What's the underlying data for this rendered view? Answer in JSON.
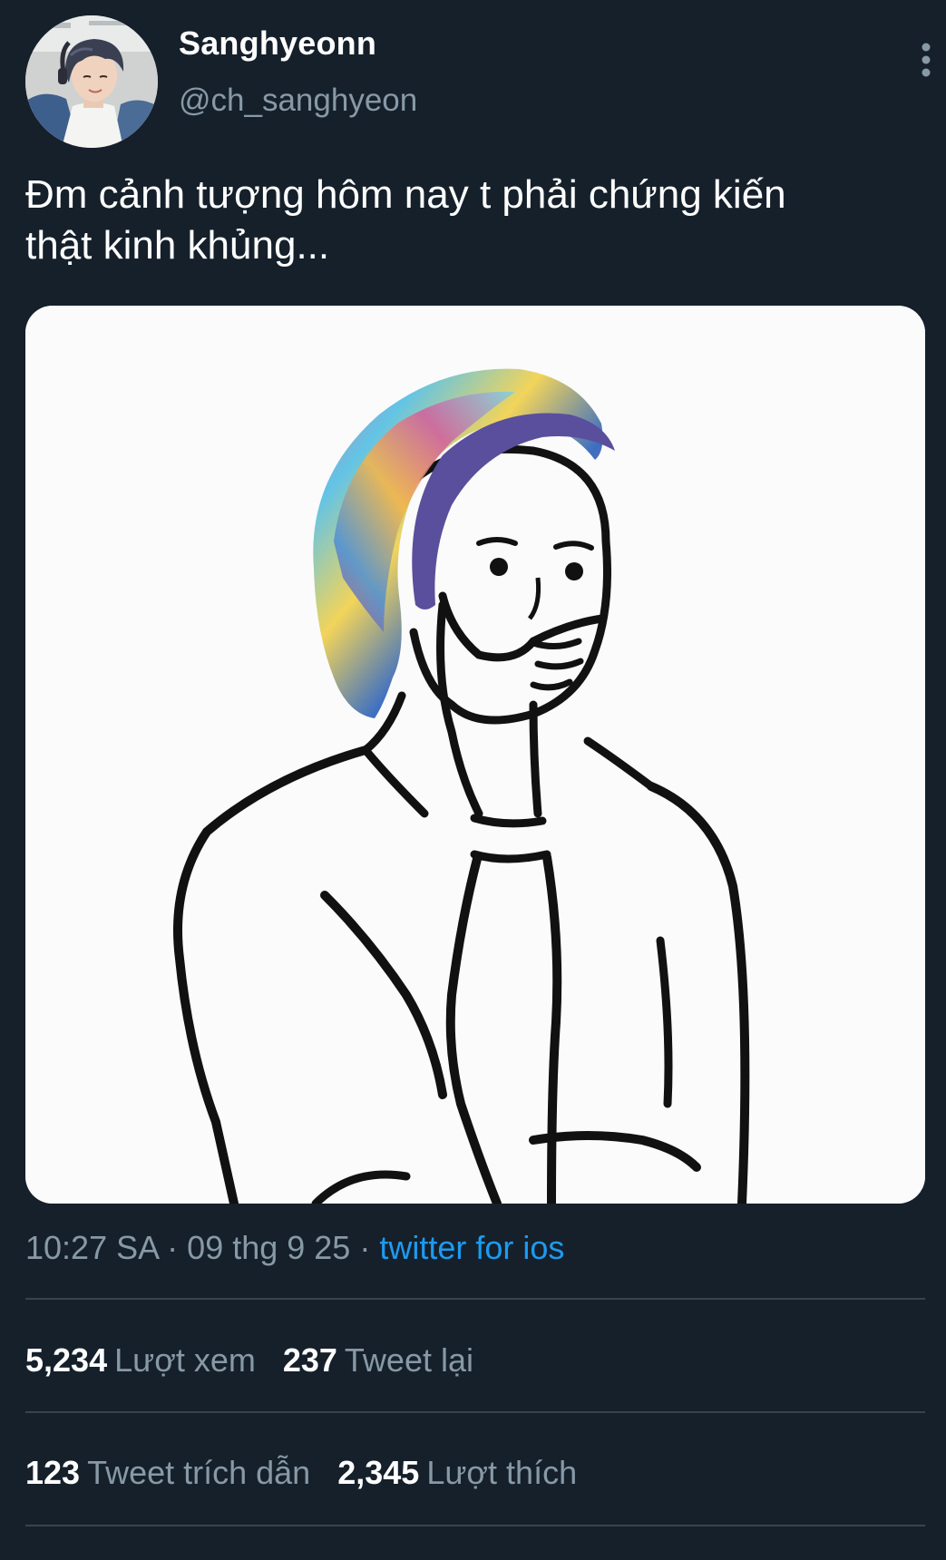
{
  "author": {
    "display_name": "Sanghyeonn",
    "handle": "@ch_sanghyeon"
  },
  "tweet": {
    "text_line1": "Đm cảnh tượng hôm nay t phải chứng kiến",
    "text_line2": "thật kinh khủng..."
  },
  "meta": {
    "time": "10:27 SA",
    "separator": "·",
    "date": "09 thg 9 25",
    "source": "twitter for ios"
  },
  "stats": {
    "views_count": "5,234",
    "views_label": "Lượt xem",
    "retweets_count": "237",
    "retweets_label": "Tweet lại",
    "quotes_count": "123",
    "quotes_label": "Tweet trích dẫn",
    "likes_count": "2,345",
    "likes_label": "Lượt thích"
  },
  "colors": {
    "background": "#15202b",
    "secondary_text": "#8899a6",
    "link": "#1d9bf0",
    "divider": "#38444d"
  },
  "icons": {
    "more": "vertical-ellipsis-icon"
  }
}
